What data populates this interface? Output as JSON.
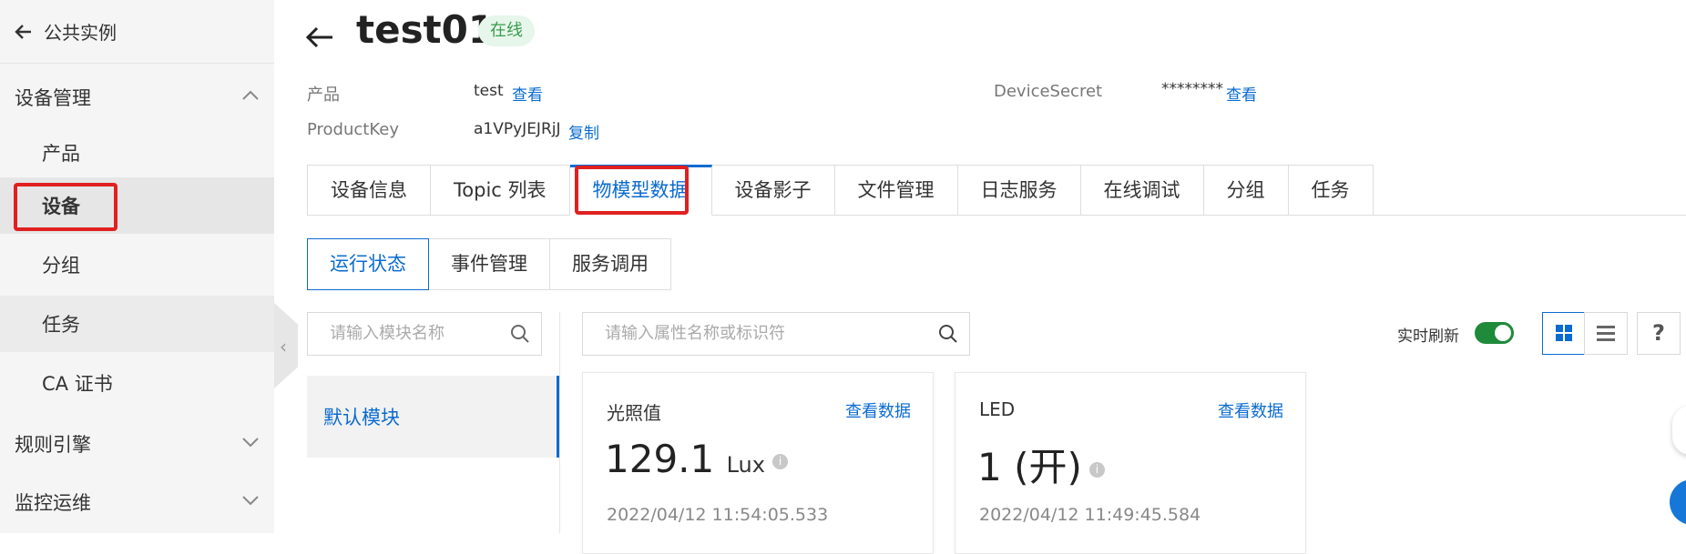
{
  "sidebar": {
    "back_label": "公共实例",
    "group_device": "设备管理",
    "items": [
      "产品",
      "设备",
      "分组",
      "任务",
      "CA 证书"
    ],
    "group_rules": "规则引擎",
    "group_monitor": "监控运维"
  },
  "header": {
    "title": "test01",
    "status": "在线",
    "product_label": "产品",
    "product_value": "test",
    "product_link": "查看",
    "productkey_label": "ProductKey",
    "productkey_value": "a1VPyJEJRjJ",
    "productkey_link": "复制",
    "secret_label": "DeviceSecret",
    "secret_value": "********",
    "secret_link": "查看"
  },
  "tabs": [
    "设备信息",
    "Topic 列表",
    "物模型数据",
    "设备影子",
    "文件管理",
    "日志服务",
    "在线调试",
    "分组",
    "任务"
  ],
  "subtabs": [
    "运行状态",
    "事件管理",
    "服务调用"
  ],
  "module_search": {
    "placeholder": "请输入模块名称"
  },
  "module_list": {
    "default": "默认模块"
  },
  "property_search": {
    "placeholder": "请输入属性名称或标识符"
  },
  "controls": {
    "realtime_label": "实时刷新",
    "realtime_on": true,
    "help": "?"
  },
  "cards": [
    {
      "name": "光照值",
      "link": "查看数据",
      "value": "129.1",
      "unit": "Lux",
      "time": "2022/04/12 11:54:05.533"
    },
    {
      "name": "LED",
      "link": "查看数据",
      "value": "1 (开)",
      "unit": "",
      "time": "2022/04/12 11:49:45.584"
    }
  ],
  "colors": {
    "accent": "#0b6bd1",
    "highlight": "#e02020",
    "online": "#3b9b4f",
    "toggle": "#1e8a3a"
  }
}
